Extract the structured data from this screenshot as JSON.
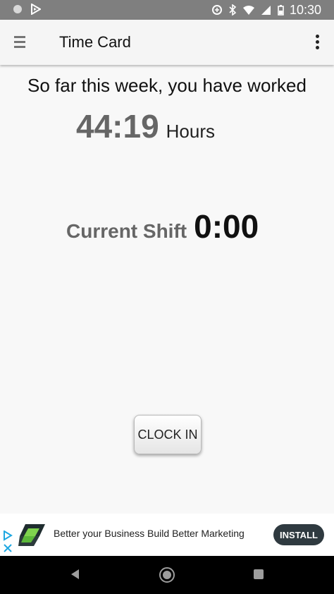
{
  "status_bar": {
    "time": "10:30",
    "icons": [
      "circle-icon",
      "play-store-icon",
      "data-saver-icon",
      "bluetooth-icon",
      "wifi-icon",
      "signal-icon",
      "battery-icon"
    ]
  },
  "app_bar": {
    "title": "Time Card",
    "menu_icon": "menu-icon",
    "more_icon": "more-vert-icon"
  },
  "summary": {
    "intro_text": "So far this week, you have worked",
    "hours_value": "44:19",
    "hours_unit": "Hours"
  },
  "shift": {
    "label": "Current Shift",
    "value": "0:00"
  },
  "actions": {
    "clock_in_label": "CLOCK IN"
  },
  "ad": {
    "text": "Better your Business Build Better Marketing",
    "install_label": "INSTALL"
  },
  "nav_bar": {
    "icons": [
      "back-icon",
      "home-icon",
      "recent-apps-icon"
    ]
  },
  "colors": {
    "status_bar_bg": "#7f7f7f",
    "app_bar_bg": "#f5f5f5",
    "background": "#f8f8f8",
    "hours_text": "#666666",
    "install_button_bg": "#2f3a40"
  }
}
